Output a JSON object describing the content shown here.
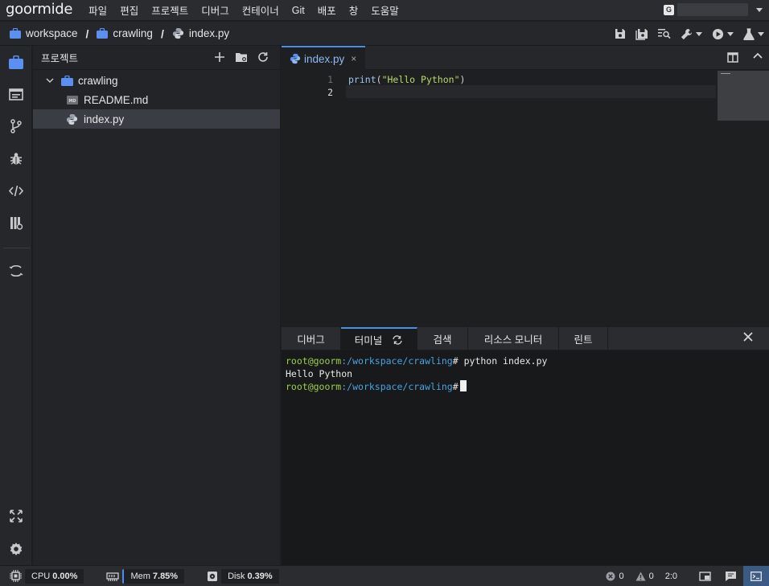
{
  "app": {
    "logo": "goormide"
  },
  "menu": [
    "파일",
    "편집",
    "프로젝트",
    "디버그",
    "컨테이너",
    "Git",
    "배포",
    "창",
    "도움말"
  ],
  "breadcrumb": {
    "workspace": "workspace",
    "folder": "crawling",
    "file": "index.py"
  },
  "project": {
    "title": "프로젝트",
    "tree": {
      "folder": "crawling",
      "files": [
        "README.md",
        "index.py"
      ],
      "selected": "index.py"
    }
  },
  "editor": {
    "tab_label": "index.py",
    "tab_close": "×",
    "line_numbers": [
      "1",
      "2"
    ],
    "code": {
      "fn": "print",
      "open": "(",
      "str": "\"Hello Python\"",
      "close": ")"
    }
  },
  "bottom_panel": {
    "tabs": [
      "디버그",
      "터미널",
      "검색",
      "리소스 모니터",
      "린트"
    ],
    "active_tab": "터미널"
  },
  "terminal": {
    "user": "root@goorm",
    "path": ":/workspace/crawling",
    "prompt": "#",
    "command": " python index.py",
    "output": "Hello Python"
  },
  "status": {
    "cpu_label": "CPU",
    "cpu_value": "0.00%",
    "mem_label": "Mem",
    "mem_value": "7.85%",
    "disk_label": "Disk",
    "disk_value": "0.39%",
    "errors": "0",
    "warnings": "0",
    "cursor_pos": "2:0"
  },
  "colors": {
    "accent": "#4a8fe7",
    "folder": "#5b8ff0",
    "terminal_user": "#9bd04a",
    "terminal_path": "#4aa3e0",
    "string": "#b9d96b"
  },
  "icons": [
    "briefcase-icon",
    "python-icon",
    "plus-icon",
    "new-folder-icon",
    "refresh-icon",
    "chevron-down-icon",
    "folder-icon",
    "markdown-file-icon",
    "save-icon",
    "save-all-icon",
    "find-icon",
    "wrench-icon",
    "run-icon",
    "flask-icon",
    "project-icon",
    "outline-icon",
    "git-branch-icon",
    "bug-icon",
    "code-icon",
    "collab-icon",
    "fullscreen-icon",
    "settings-icon",
    "split-editor-icon",
    "chevron-up-icon",
    "close-icon",
    "error-icon",
    "warning-icon",
    "terminal-icon"
  ]
}
